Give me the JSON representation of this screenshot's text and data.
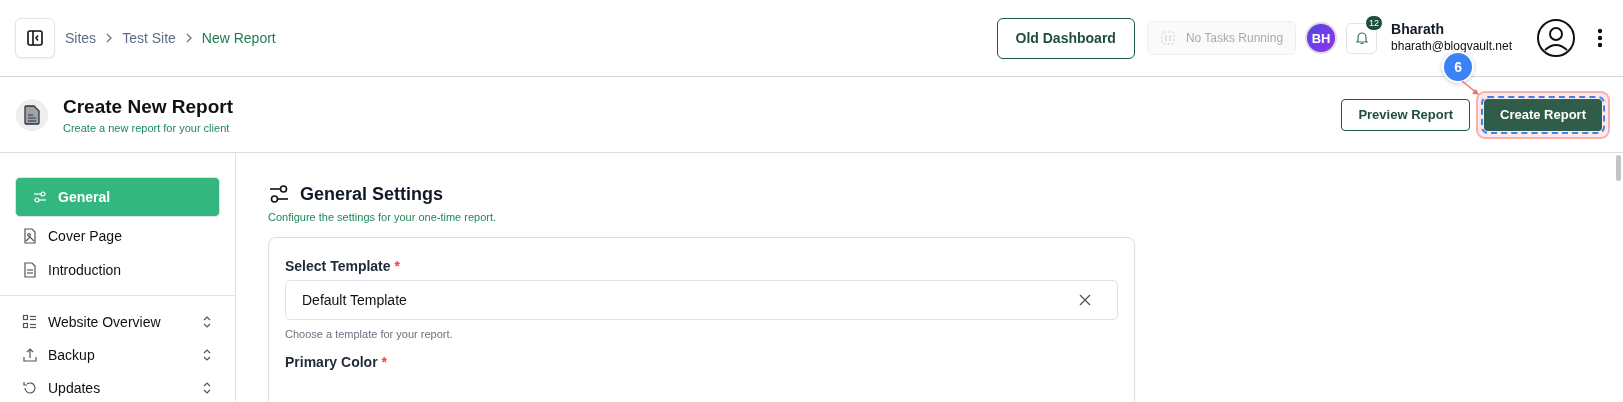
{
  "header": {
    "breadcrumb": [
      {
        "label": "Sites",
        "current": false
      },
      {
        "label": "Test Site",
        "current": false
      },
      {
        "label": "New Report",
        "current": true
      }
    ],
    "old_dashboard": "Old Dashboard",
    "tasks": {
      "label": "No Tasks Running",
      "disabled": true
    },
    "avatar_initials": "BH",
    "notifications": "12",
    "user": {
      "name": "Bharath",
      "email": "bharath@blogvault.net"
    }
  },
  "page": {
    "title": "Create New Report",
    "subtitle": "Create a new report for your client",
    "buttons": [
      {
        "label": "Preview Report",
        "kind": "outline"
      },
      {
        "label": "Create Report",
        "kind": "primary",
        "highlighted": true
      }
    ],
    "annotation": "6"
  },
  "sidebar": {
    "sections": [
      [
        {
          "label": "General",
          "selected": true
        },
        {
          "label": "Cover Page",
          "selected": false
        },
        {
          "label": "Introduction",
          "selected": false
        }
      ],
      [
        {
          "label": "Website Overview",
          "selected": false,
          "expanded": false
        },
        {
          "label": "Backup",
          "selected": false,
          "expanded": false
        },
        {
          "label": "Updates",
          "selected": false,
          "expanded": false
        }
      ]
    ]
  },
  "settings": {
    "title": "General Settings",
    "subtitle": "Configure the settings for your one-time report.",
    "fields": [
      {
        "label": "Select Template",
        "required_mark": "*",
        "kind": "select",
        "value": "Default Template",
        "helper": "Choose a template for your report."
      },
      {
        "label": "Primary Color",
        "required_mark": "*",
        "kind": "color"
      }
    ]
  }
}
